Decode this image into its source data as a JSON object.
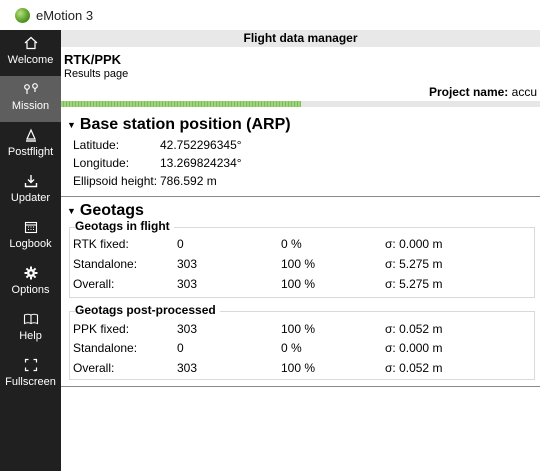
{
  "window": {
    "title": "eMotion 3"
  },
  "sidebar": {
    "items": [
      {
        "label": "Welcome",
        "icon": "home-icon"
      },
      {
        "label": "Mission",
        "icon": "waypoints-icon"
      },
      {
        "label": "Postflight",
        "icon": "postflight-icon"
      },
      {
        "label": "Updater",
        "icon": "download-icon"
      },
      {
        "label": "Logbook",
        "icon": "calendar-icon"
      },
      {
        "label": "Options",
        "icon": "gear-icon"
      },
      {
        "label": "Help",
        "icon": "book-icon"
      },
      {
        "label": "Fullscreen",
        "icon": "fullscreen-icon"
      }
    ]
  },
  "header": {
    "title": "Flight data manager"
  },
  "page": {
    "title": "RTK/PPK",
    "subtitle": "Results page",
    "project_label": "Project name:",
    "project_value": "accu",
    "progress_fraction": 0.5
  },
  "base_station": {
    "title": "Base station position (ARP)",
    "rows": [
      {
        "label": "Latitude:",
        "value": "42.752296345°"
      },
      {
        "label": "Longitude:",
        "value": "13.269824234°"
      },
      {
        "label": "Ellipsoid height:",
        "value": "786.592 m"
      }
    ]
  },
  "geotags": {
    "title": "Geotags",
    "in_flight": {
      "title": "Geotags in flight",
      "rows": [
        {
          "label": "RTK fixed:",
          "count": "0",
          "percent": "0 %",
          "sigma": "σ: 0.000 m"
        },
        {
          "label": "Standalone:",
          "count": "303",
          "percent": "100 %",
          "sigma": "σ: 5.275 m"
        },
        {
          "label": "Overall:",
          "count": "303",
          "percent": "100 %",
          "sigma": "σ: 5.275 m"
        }
      ]
    },
    "post_processed": {
      "title": "Geotags post-processed",
      "rows": [
        {
          "label": "PPK fixed:",
          "count": "303",
          "percent": "100 %",
          "sigma": "σ: 0.052 m"
        },
        {
          "label": "Standalone:",
          "count": "0",
          "percent": "0 %",
          "sigma": "σ: 0.000 m"
        },
        {
          "label": "Overall:",
          "count": "303",
          "percent": "100 %",
          "sigma": "σ: 0.052 m"
        }
      ]
    }
  }
}
